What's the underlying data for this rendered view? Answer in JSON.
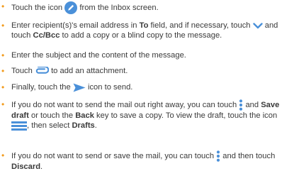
{
  "bullet_char": "•",
  "items": [
    {
      "a": "Touch the icon",
      "b": "from the Inbox screen."
    },
    {
      "a": "Enter recipient(s)'s email address in",
      "bold1": "To",
      "b": "field, and if necessary, touch",
      "c": "and touch",
      "bold2": "Cc/Bcc",
      "d": "to add a copy or a blind copy to the message."
    },
    {
      "a": "Enter the subject and the content of the message."
    },
    {
      "a": "Touch",
      "b": "to add an attachment."
    },
    {
      "a": "Finally, touch the",
      "b": "icon to send."
    },
    {
      "a": "If you do not want to send the mail out right away, you can touch",
      "b": "and",
      "bold1": "Save draft",
      "c": "or touch the",
      "bold2": "Back",
      "d": "key to save a copy. To view the draft, touch the icon",
      "e": ", then select",
      "bold3": "Drafts",
      "f": "."
    },
    {
      "a": "If you do not want to send or save the mail, you can touch",
      "b": "and then touch",
      "bold1": "Discard",
      "c": "."
    }
  ],
  "icons": {
    "compose": "pencil-in-circle-icon",
    "expand": "chevron-down-icon",
    "attach": "paperclip-icon",
    "send": "send-arrow-icon",
    "menu": "three-dot-menu-icon",
    "drawer": "hamburger-menu-icon"
  },
  "colors": {
    "bullet": "#f29b1d",
    "icon_blue": "#4a90d9",
    "text": "#3a3a3a"
  }
}
